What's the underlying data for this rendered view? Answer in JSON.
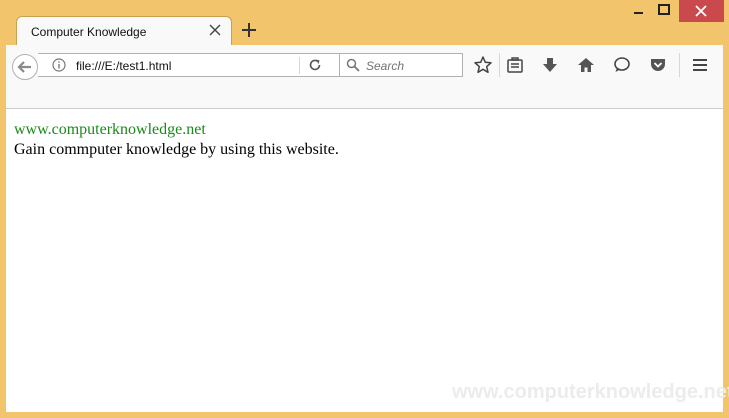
{
  "tab": {
    "title": "Computer Knowledge"
  },
  "urlbar": {
    "url": "file:///E:/test1.html"
  },
  "searchbar": {
    "placeholder": "Search"
  },
  "page": {
    "link_text": "www.computerknowledge.net",
    "body_text": "Gain commputer knowledge by using this website."
  },
  "watermark": "www.computerknowledge.net",
  "colors": {
    "frame": "#f2c56c",
    "window_close": "#c9494c",
    "link": "#1a8a1a"
  }
}
